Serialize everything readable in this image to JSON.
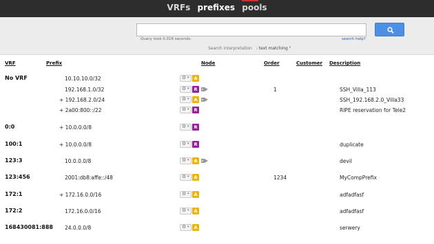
{
  "nav": {
    "items": [
      "VRFs",
      "prefixes",
      "pools"
    ],
    "active": "prefixes"
  },
  "search": {
    "query_time": "Query took 0.018 seconds.",
    "help_label": "search help?",
    "interpretation_label": "Search interpretation",
    "interpretation_value": ": text matching \""
  },
  "columns": {
    "vrf": "VRF",
    "prefix": "Prefix",
    "node": "Node",
    "order": "Order",
    "customer": "Customer",
    "description": "Description"
  },
  "rows": [
    {
      "vrf": "No VRF",
      "prefix": "10.10.10.0/32",
      "badge": "A",
      "tag": false,
      "order": "",
      "description": ""
    },
    {
      "vrf": "",
      "prefix": "192.168.1.0/32",
      "badge": "R",
      "tag": true,
      "order": "1",
      "description": "SSH_Villa_113"
    },
    {
      "vrf": "",
      "prefix": "+ 192.168.2.0/24",
      "badge": "A",
      "tag": true,
      "order": "",
      "description": "SSH_192.168.2.0_Villa33"
    },
    {
      "vrf": "",
      "prefix": "+ 2a00:800::/22",
      "badge": "R",
      "tag": false,
      "order": "",
      "description": "RIPE reservation for Tele2"
    },
    {
      "vrf": "0:0",
      "prefix": "+ 10.0.0.0/8",
      "badge": "R",
      "tag": false,
      "order": "",
      "description": ""
    },
    {
      "vrf": "100:1",
      "prefix": "+ 10.0.0.0/8",
      "badge": "R",
      "tag": false,
      "order": "",
      "description": "duplicate"
    },
    {
      "vrf": "123:3",
      "prefix": "10.0.0.0/8",
      "badge": "A",
      "tag": true,
      "order": "",
      "description": "devil"
    },
    {
      "vrf": "123:456",
      "prefix": "2001:db8:affe::/48",
      "badge": "A",
      "tag": false,
      "order": "1234",
      "description": "MyCompPrefix"
    },
    {
      "vrf": "172:1",
      "prefix": "+ 172.16.0.0/16",
      "badge": "A",
      "tag": false,
      "order": "",
      "description": "adfadfasf"
    },
    {
      "vrf": "172:2",
      "prefix": "172.16.0.0/16",
      "badge": "A",
      "tag": false,
      "order": "",
      "description": "adfadfasf"
    },
    {
      "vrf": "168430081:888",
      "prefix": "24.0.0.0/8",
      "badge": "A",
      "tag": false,
      "order": "",
      "description": "serwery"
    }
  ]
}
